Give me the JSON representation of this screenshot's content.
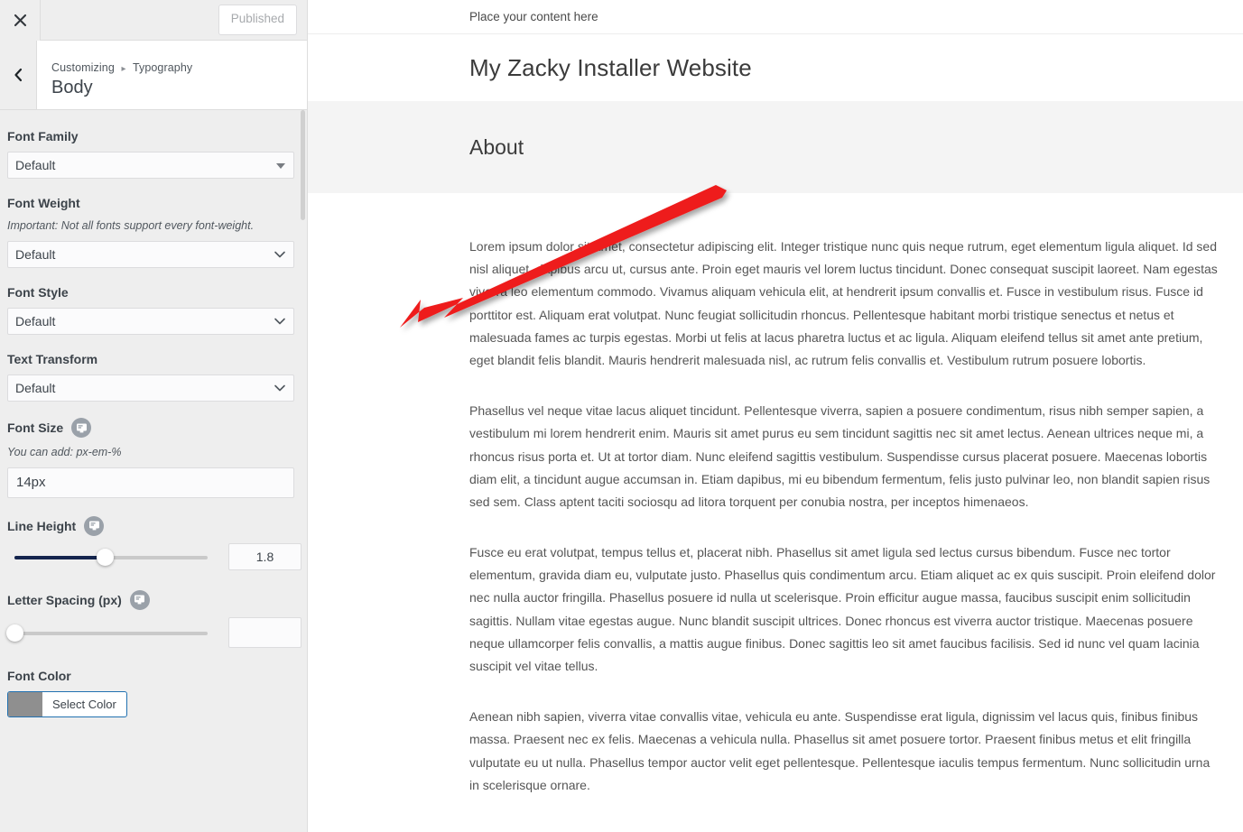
{
  "customizer": {
    "topbar": {
      "close_icon": "close-x-icon",
      "published_label": "Published"
    },
    "header": {
      "back_icon": "chevron-left-icon",
      "breadcrumb_root": "Customizing",
      "breadcrumb_separator": "▸",
      "breadcrumb_section": "Typography",
      "panel_title": "Body"
    },
    "fields": {
      "font_family": {
        "label": "Font Family",
        "value": "Default",
        "arrow_icon": "triangle-down-icon"
      },
      "font_weight": {
        "label": "Font Weight",
        "description": "Important: Not all fonts support every font-weight.",
        "value": "Default",
        "arrow_icon": "chevron-down-icon"
      },
      "font_style": {
        "label": "Font Style",
        "value": "Default",
        "arrow_icon": "chevron-down-icon"
      },
      "text_transform": {
        "label": "Text Transform",
        "value": "Default",
        "arrow_icon": "chevron-down-icon"
      },
      "font_size": {
        "label": "Font Size",
        "reset_icon": "device-preview-icon",
        "description": "You can add: px-em-%",
        "value": "14px"
      },
      "line_height": {
        "label": "Line Height",
        "reset_icon": "device-preview-icon",
        "value": "1.8",
        "slider_percent": 47
      },
      "letter_spacing": {
        "label": "Letter Spacing (px)",
        "reset_icon": "device-preview-icon",
        "value": "",
        "slider_percent": 0
      },
      "font_color": {
        "label": "Font Color",
        "button_label": "Select Color",
        "swatch_color": "#8f8f8f"
      }
    }
  },
  "preview": {
    "top_note": "Place your content here",
    "site_title": "My Zacky Installer Website",
    "section_heading": "About",
    "paragraphs": [
      "Lorem ipsum dolor sit amet, consectetur adipiscing elit. Integer tristique nunc quis neque rutrum, eget elementum ligula aliquet. Id sed nisl aliquet, dapibus arcu ut, cursus ante. Proin eget mauris vel lorem luctus tincidunt. Donec consequat suscipit laoreet. Nam egestas viverra leo elementum commodo. Vivamus aliquam vehicula elit, at hendrerit ipsum convallis et. Fusce in vestibulum risus. Fusce id porttitor est. Aliquam erat volutpat. Nunc feugiat sollicitudin rhoncus. Pellentesque habitant morbi tristique senectus et netus et malesuada fames ac turpis egestas. Morbi ut felis at lacus pharetra luctus et ac ligula. Aliquam eleifend tellus sit amet ante pretium, eget blandit felis blandit. Mauris hendrerit malesuada nisl, ac rutrum felis convallis et. Vestibulum rutrum posuere lobortis.",
      "Phasellus vel neque vitae lacus aliquet tincidunt. Pellentesque viverra, sapien a posuere condimentum, risus nibh semper sapien, a vestibulum mi lorem hendrerit enim. Mauris sit amet purus eu sem tincidunt sagittis nec sit amet lectus. Aenean ultrices neque mi, a rhoncus risus porta et. Ut at tortor diam. Nunc eleifend sagittis vestibulum. Suspendisse cursus placerat posuere. Maecenas lobortis diam elit, a tincidunt augue accumsan in. Etiam dapibus, mi eu bibendum fermentum, felis justo pulvinar leo, non blandit sapien risus sed sem. Class aptent taciti sociosqu ad litora torquent per conubia nostra, per inceptos himenaeos.",
      "Fusce eu erat volutpat, tempus tellus et, placerat nibh. Phasellus sit amet ligula sed lectus cursus bibendum. Fusce nec tortor elementum, gravida diam eu, vulputate justo. Phasellus quis condimentum arcu. Etiam aliquet ac ex quis suscipit. Proin eleifend dolor nec nulla auctor fringilla. Phasellus posuere id nulla ut scelerisque. Proin efficitur augue massa, faucibus suscipit enim sollicitudin sagittis. Nullam vitae egestas augue. Nunc blandit suscipit ultrices. Donec rhoncus est viverra auctor tristique. Maecenas posuere neque ullamcorper felis convallis, a mattis augue finibus. Donec sagittis leo sit amet faucibus facilisis. Sed id nunc vel quam lacinia suscipit vel vitae tellus.",
      "Aenean nibh sapien, viverra vitae convallis vitae, vehicula eu ante. Suspendisse erat ligula, dignissim vel lacus quis, finibus finibus massa. Praesent nec ex felis. Maecenas a vehicula nulla. Phasellus sit amet posuere tortor. Praesent finibus metus et elit fringilla vulputate eu ut nulla. Phasellus tempor auctor velit eget pellentesque. Pellentesque iaculis tempus fermentum. Nunc sollicitudin urna in scelerisque ornare."
    ]
  },
  "annotation": {
    "arrow_color": "#ee1c1c",
    "arrow_icon": "red-arrow-pointing-down-left"
  }
}
